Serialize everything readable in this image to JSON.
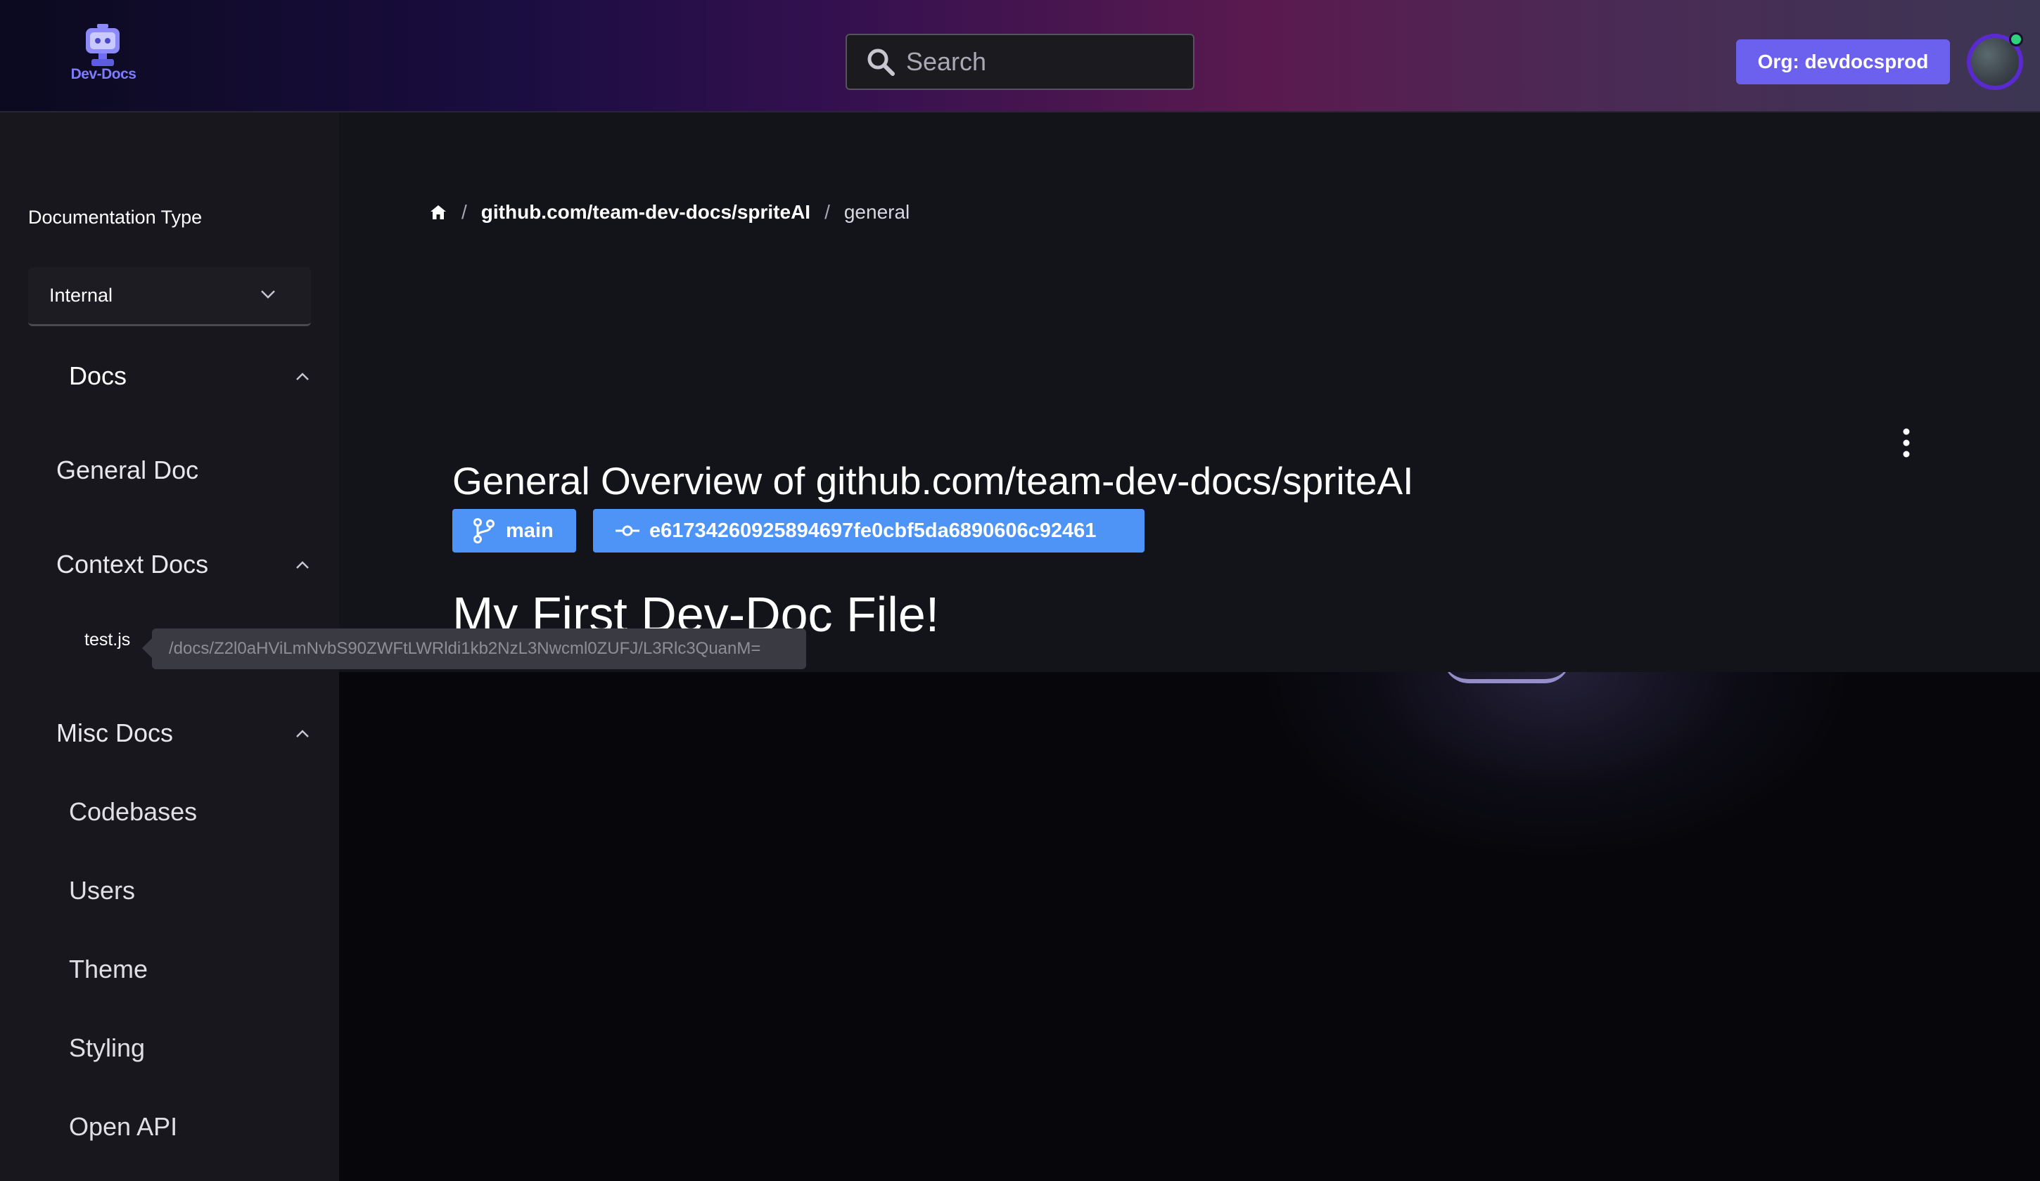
{
  "header": {
    "logo_text": "Dev-Docs",
    "search_placeholder": "Search",
    "org_button_label": "Org: devdocsprod"
  },
  "sidebar": {
    "section_heading": "Documentation Type",
    "doc_type_selected": "Internal",
    "groups": {
      "docs": "Docs",
      "general_doc": "General Doc",
      "context_docs": "Context Docs",
      "context_file": "test.js",
      "misc_docs": "Misc Docs"
    },
    "misc_items": [
      "Codebases",
      "Users",
      "Theme",
      "Styling",
      "Open API"
    ]
  },
  "tooltip": {
    "text": "/docs/Z2l0aHViLmNvbS90ZWFtLWRldi1kb2NzL3Nwcml0ZUFJ/L3Rlc3QuanM="
  },
  "breadcrumb": {
    "separator": "/",
    "repo": "github.com/team-dev-docs/spriteAI",
    "current": "general"
  },
  "main": {
    "title": "General Overview of github.com/team-dev-docs/spriteAI",
    "branch": "main",
    "commit": "e61734260925894697fe0cbf5da6890606c92461",
    "doc_heading": "My First Dev-Doc File!"
  },
  "colors": {
    "accent": "#6b61ee",
    "badge": "#4e94f6",
    "sidebar_bg": "#18171d",
    "main_bg": "#13131a"
  }
}
